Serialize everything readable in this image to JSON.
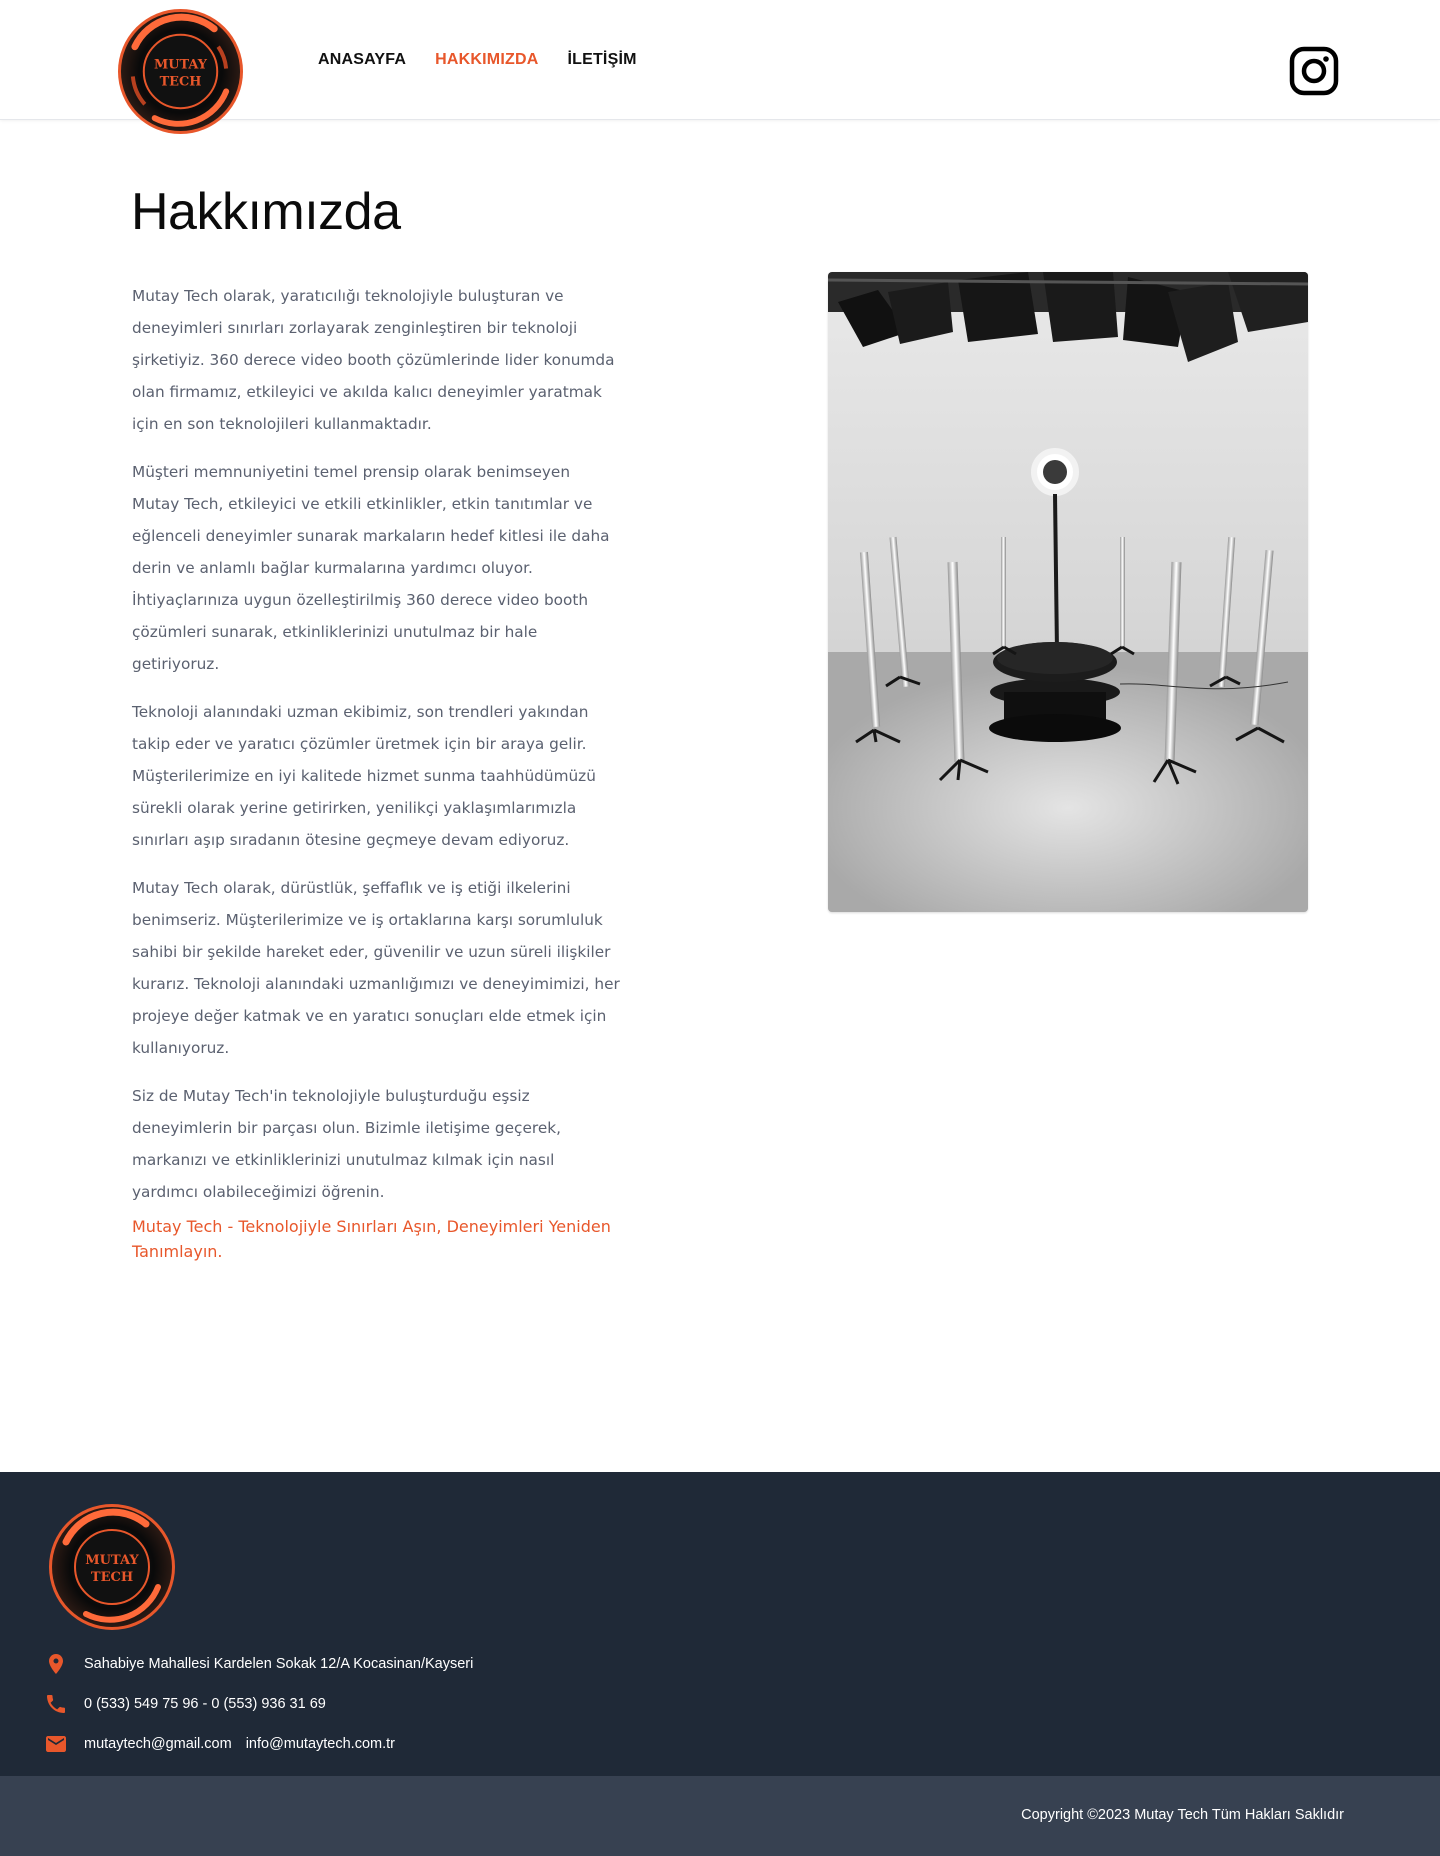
{
  "brand": {
    "logo_text_line1": "MUTAY",
    "logo_text_line2": "TECH",
    "accent_color": "#e8572b",
    "footer_bg": "#1f2937",
    "bottom_bar_bg": "#374151"
  },
  "nav": {
    "items": [
      {
        "label": "ANASAYFA",
        "active": false
      },
      {
        "label": "HAKKIMIZDA",
        "active": true
      },
      {
        "label": "İLETİŞİM",
        "active": false
      }
    ],
    "social_icon": "instagram-icon"
  },
  "main": {
    "title": "Hakkımızda",
    "paragraphs": [
      "Mutay Tech olarak, yaratıcılığı teknolojiyle buluşturan ve deneyimleri sınırları zorlayarak zenginleştiren bir teknoloji şirketiyiz. 360 derece video booth çözümlerinde lider konumda olan firmamız, etkileyici ve akılda kalıcı deneyimler yaratmak için en son teknolojileri kullanmaktadır.",
      "Müşteri memnuniyetini temel prensip olarak benimseyen Mutay Tech, etkileyici ve etkili etkinlikler, etkin tanıtımlar ve eğlenceli deneyimler sunarak markaların hedef kitlesi ile daha derin ve anlamlı bağlar kurmalarına yardımcı oluyor. İhtiyaçlarınıza uygun özelleştirilmiş 360 derece video booth çözümleri sunarak, etkinliklerinizi unutulmaz bir hale getiriyoruz.",
      "Teknoloji alanındaki uzman ekibimiz, son trendleri yakından takip eder ve yaratıcı çözümler üretmek için bir araya gelir. Müşterilerimize en iyi kalitede hizmet sunma taahhüdümüzü sürekli olarak yerine getirirken, yenilikçi yaklaşımlarımızla sınırları aşıp sıradanın ötesine geçmeye devam ediyoruz.",
      "Mutay Tech olarak, dürüstlük, şeffaflık ve iş etiği ilkelerini benimseriz. Müşterilerimize ve iş ortaklarına karşı sorumluluk sahibi bir şekilde hareket eder, güvenilir ve uzun süreli ilişkiler kurarız. Teknoloji alanındaki uzmanlığımızı ve deneyimimizi, her projeye değer katmak ve en yaratıcı sonuçları elde etmek için kullanıyoruz.",
      "Siz de Mutay Tech'in teknolojiyle buluşturduğu eşsiz deneyimlerin bir parçası olun. Bizimle iletişime geçerek, markanızı ve etkinliklerinizi unutulmaz kılmak için nasıl yardımcı olabileceğimizi öğrenin."
    ],
    "slogan": "Mutay Tech - Teknolojiyle Sınırları Aşın, Deneyimleri Yeniden Tanımlayın."
  },
  "footer": {
    "address": "Sahabiye Mahallesi Kardelen Sokak 12/A Kocasinan/Kayseri",
    "phone": "0 (533) 549 75 96 - 0 (553) 936 31 69",
    "email_1": "mutaytech@gmail.com",
    "email_2": "info@mutaytech.com.tr",
    "copyright": "Copyright ©2023 Mutay Tech Tüm Hakları Saklıdır"
  }
}
